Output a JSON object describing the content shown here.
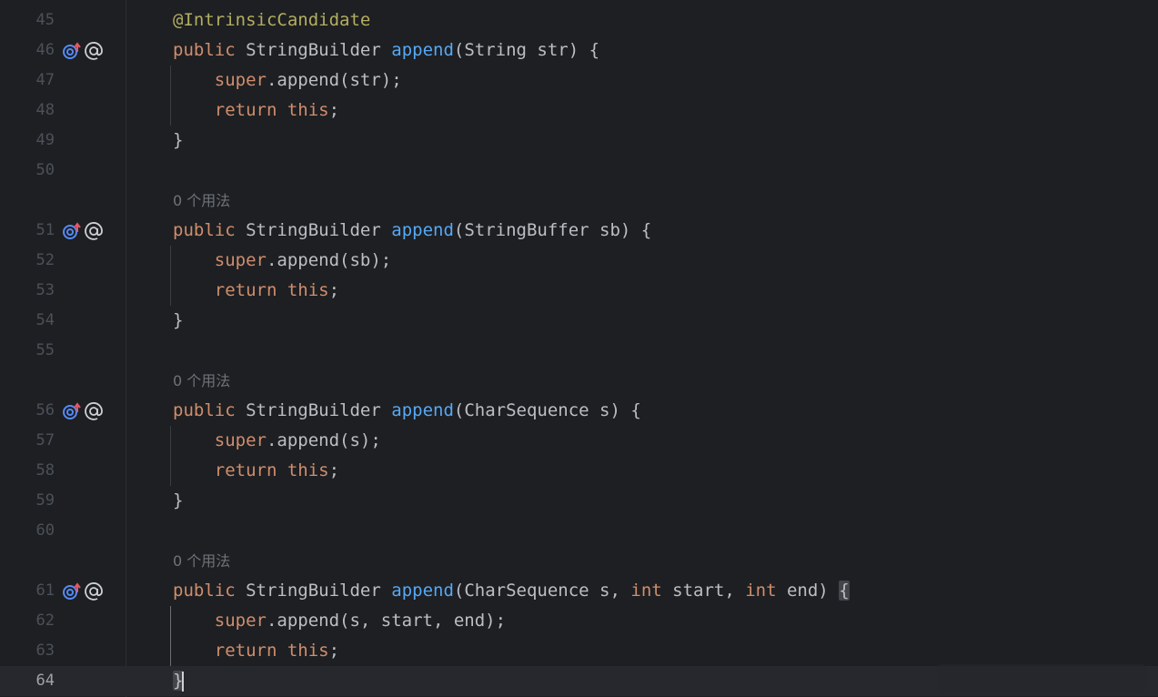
{
  "editor": {
    "current_line": "64",
    "hint_text": "0 个用法",
    "colors": {
      "background": "#1e1f22",
      "keyword": "#cf8e6d",
      "method": "#56a8f5",
      "annotation": "#b3ae60",
      "text": "#bcbec4",
      "line_number": "#4b5059"
    },
    "gutter_icons": [
      "overrides-method-icon",
      "annotation-at-icon"
    ],
    "lines": [
      {
        "num": "45",
        "ann": "@IntrinsicCandidate"
      },
      {
        "num": "46",
        "kw1": "public",
        "type": "StringBuilder",
        "fn": "append",
        "params": "(String str) {"
      },
      {
        "num": "47",
        "kw1": "super",
        "rest": ".append(str);"
      },
      {
        "num": "48",
        "kw1": "return",
        "kw2": "this",
        "rest": ";"
      },
      {
        "num": "49",
        "text": "}"
      },
      {
        "num": "50"
      },
      {
        "num": "51",
        "kw1": "public",
        "type": "StringBuilder",
        "fn": "append",
        "params": "(StringBuffer sb) {"
      },
      {
        "num": "52",
        "kw1": "super",
        "rest": ".append(sb);"
      },
      {
        "num": "53",
        "kw1": "return",
        "kw2": "this",
        "rest": ";"
      },
      {
        "num": "54",
        "text": "}"
      },
      {
        "num": "55"
      },
      {
        "num": "56",
        "kw1": "public",
        "type": "StringBuilder",
        "fn": "append",
        "params": "(CharSequence s) {"
      },
      {
        "num": "57",
        "kw1": "super",
        "rest": ".append(s);"
      },
      {
        "num": "58",
        "kw1": "return",
        "kw2": "this",
        "rest": ";"
      },
      {
        "num": "59",
        "text": "}"
      },
      {
        "num": "60"
      },
      {
        "num": "61",
        "kw1": "public",
        "type": "StringBuilder",
        "fn": "append",
        "p1": "(CharSequence s, ",
        "kw_int": "int",
        "p2": " start, ",
        "p3": " end) ",
        "brace": "{"
      },
      {
        "num": "62",
        "kw1": "super",
        "rest": ".append(s, start, end);"
      },
      {
        "num": "63",
        "kw1": "return",
        "kw2": "this",
        "rest": ";"
      },
      {
        "num": "64",
        "text": "}"
      }
    ]
  }
}
